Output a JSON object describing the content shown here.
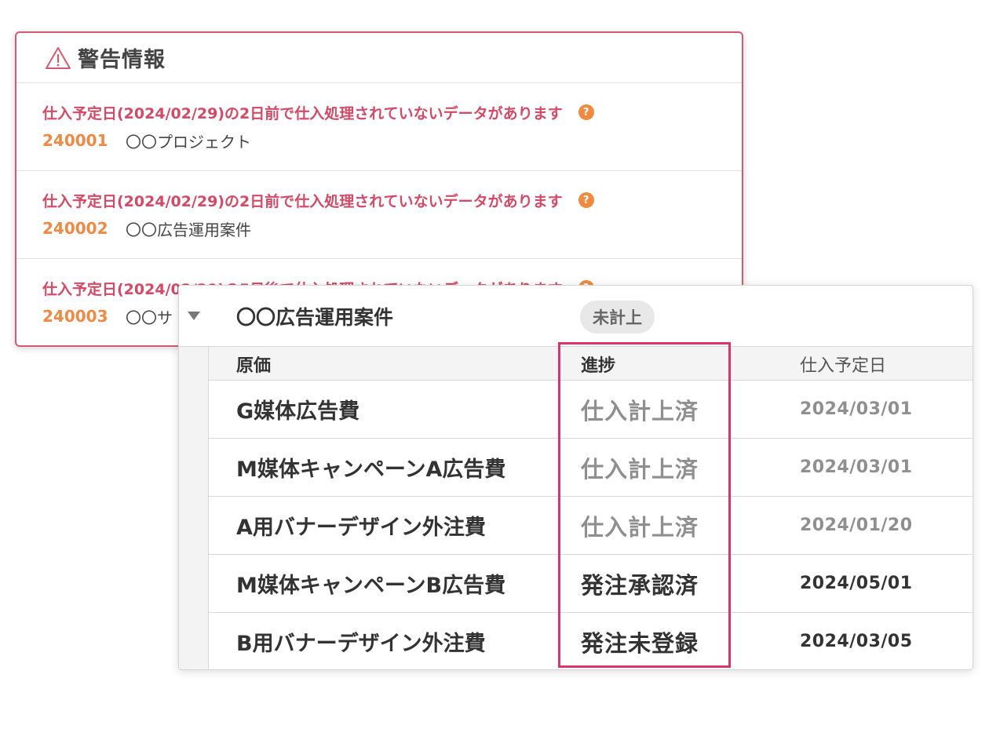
{
  "warning_panel": {
    "title": "警告情報",
    "items": [
      {
        "message": "仕入予定日(2024/02/29)の2日前で仕入処理されていないデータがあります",
        "code": "240001",
        "project": "〇〇プロジェクト"
      },
      {
        "message": "仕入予定日(2024/02/29)の2日前で仕入処理されていないデータがあります",
        "code": "240002",
        "project": "〇〇広告運用案件"
      },
      {
        "message": "仕入予定日(2024/02/29)の5日後で仕入処理されていないデータがあります",
        "code": "240003",
        "project": "〇〇サ"
      }
    ],
    "help_icon_glyph": "?"
  },
  "cost_table": {
    "group_name": "〇〇広告運用案件",
    "group_status": "未計上",
    "headers": {
      "cost": "原価",
      "progress": "進捗",
      "date": "仕入予定日"
    },
    "rows": [
      {
        "cost": "G媒体広告費",
        "progress": "仕入計上済",
        "date": "2024/03/01"
      },
      {
        "cost": "M媒体キャンペーンA広告費",
        "progress": "仕入計上済",
        "date": "2024/03/01"
      },
      {
        "cost": "A用バナーデザイン外注費",
        "progress": "仕入計上済",
        "date": "2024/01/20"
      },
      {
        "cost": "M媒体キャンペーンB広告費",
        "progress": "発注承認済",
        "date": "2024/05/01"
      },
      {
        "cost": "B用バナーデザイン外注費",
        "progress": "発注未登録",
        "date": "2024/03/05"
      }
    ]
  },
  "colors": {
    "warning_border": "#d35a72",
    "warning_text": "#d24a66",
    "code_text": "#ef8a46",
    "help_icon": "#f08a3e",
    "highlight": "#d9366e",
    "muted_text": "#8f8f8f"
  }
}
